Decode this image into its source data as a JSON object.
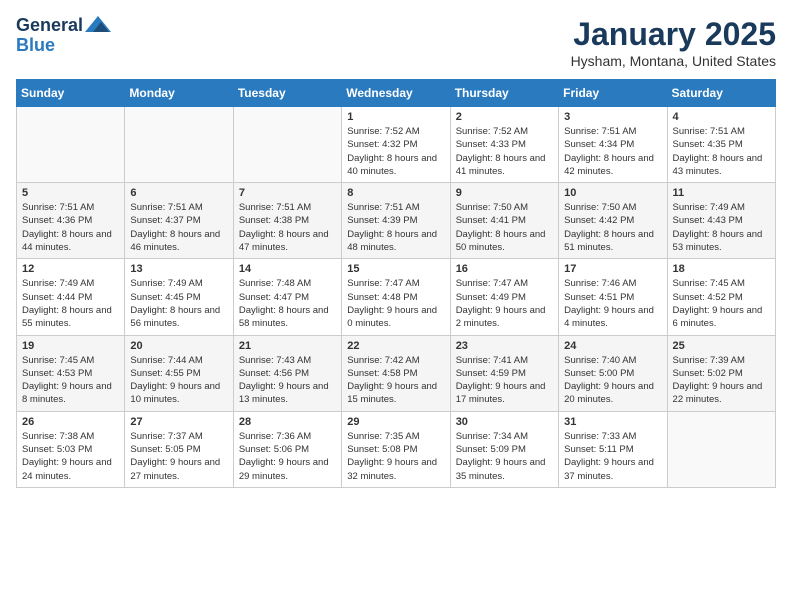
{
  "logo": {
    "general": "General",
    "blue": "Blue"
  },
  "header": {
    "month": "January 2025",
    "location": "Hysham, Montana, United States"
  },
  "weekdays": [
    "Sunday",
    "Monday",
    "Tuesday",
    "Wednesday",
    "Thursday",
    "Friday",
    "Saturday"
  ],
  "weeks": [
    [
      {
        "day": "",
        "sunrise": "",
        "sunset": "",
        "daylight": ""
      },
      {
        "day": "",
        "sunrise": "",
        "sunset": "",
        "daylight": ""
      },
      {
        "day": "",
        "sunrise": "",
        "sunset": "",
        "daylight": ""
      },
      {
        "day": "1",
        "sunrise": "Sunrise: 7:52 AM",
        "sunset": "Sunset: 4:32 PM",
        "daylight": "Daylight: 8 hours and 40 minutes."
      },
      {
        "day": "2",
        "sunrise": "Sunrise: 7:52 AM",
        "sunset": "Sunset: 4:33 PM",
        "daylight": "Daylight: 8 hours and 41 minutes."
      },
      {
        "day": "3",
        "sunrise": "Sunrise: 7:51 AM",
        "sunset": "Sunset: 4:34 PM",
        "daylight": "Daylight: 8 hours and 42 minutes."
      },
      {
        "day": "4",
        "sunrise": "Sunrise: 7:51 AM",
        "sunset": "Sunset: 4:35 PM",
        "daylight": "Daylight: 8 hours and 43 minutes."
      }
    ],
    [
      {
        "day": "5",
        "sunrise": "Sunrise: 7:51 AM",
        "sunset": "Sunset: 4:36 PM",
        "daylight": "Daylight: 8 hours and 44 minutes."
      },
      {
        "day": "6",
        "sunrise": "Sunrise: 7:51 AM",
        "sunset": "Sunset: 4:37 PM",
        "daylight": "Daylight: 8 hours and 46 minutes."
      },
      {
        "day": "7",
        "sunrise": "Sunrise: 7:51 AM",
        "sunset": "Sunset: 4:38 PM",
        "daylight": "Daylight: 8 hours and 47 minutes."
      },
      {
        "day": "8",
        "sunrise": "Sunrise: 7:51 AM",
        "sunset": "Sunset: 4:39 PM",
        "daylight": "Daylight: 8 hours and 48 minutes."
      },
      {
        "day": "9",
        "sunrise": "Sunrise: 7:50 AM",
        "sunset": "Sunset: 4:41 PM",
        "daylight": "Daylight: 8 hours and 50 minutes."
      },
      {
        "day": "10",
        "sunrise": "Sunrise: 7:50 AM",
        "sunset": "Sunset: 4:42 PM",
        "daylight": "Daylight: 8 hours and 51 minutes."
      },
      {
        "day": "11",
        "sunrise": "Sunrise: 7:49 AM",
        "sunset": "Sunset: 4:43 PM",
        "daylight": "Daylight: 8 hours and 53 minutes."
      }
    ],
    [
      {
        "day": "12",
        "sunrise": "Sunrise: 7:49 AM",
        "sunset": "Sunset: 4:44 PM",
        "daylight": "Daylight: 8 hours and 55 minutes."
      },
      {
        "day": "13",
        "sunrise": "Sunrise: 7:49 AM",
        "sunset": "Sunset: 4:45 PM",
        "daylight": "Daylight: 8 hours and 56 minutes."
      },
      {
        "day": "14",
        "sunrise": "Sunrise: 7:48 AM",
        "sunset": "Sunset: 4:47 PM",
        "daylight": "Daylight: 8 hours and 58 minutes."
      },
      {
        "day": "15",
        "sunrise": "Sunrise: 7:47 AM",
        "sunset": "Sunset: 4:48 PM",
        "daylight": "Daylight: 9 hours and 0 minutes."
      },
      {
        "day": "16",
        "sunrise": "Sunrise: 7:47 AM",
        "sunset": "Sunset: 4:49 PM",
        "daylight": "Daylight: 9 hours and 2 minutes."
      },
      {
        "day": "17",
        "sunrise": "Sunrise: 7:46 AM",
        "sunset": "Sunset: 4:51 PM",
        "daylight": "Daylight: 9 hours and 4 minutes."
      },
      {
        "day": "18",
        "sunrise": "Sunrise: 7:45 AM",
        "sunset": "Sunset: 4:52 PM",
        "daylight": "Daylight: 9 hours and 6 minutes."
      }
    ],
    [
      {
        "day": "19",
        "sunrise": "Sunrise: 7:45 AM",
        "sunset": "Sunset: 4:53 PM",
        "daylight": "Daylight: 9 hours and 8 minutes."
      },
      {
        "day": "20",
        "sunrise": "Sunrise: 7:44 AM",
        "sunset": "Sunset: 4:55 PM",
        "daylight": "Daylight: 9 hours and 10 minutes."
      },
      {
        "day": "21",
        "sunrise": "Sunrise: 7:43 AM",
        "sunset": "Sunset: 4:56 PM",
        "daylight": "Daylight: 9 hours and 13 minutes."
      },
      {
        "day": "22",
        "sunrise": "Sunrise: 7:42 AM",
        "sunset": "Sunset: 4:58 PM",
        "daylight": "Daylight: 9 hours and 15 minutes."
      },
      {
        "day": "23",
        "sunrise": "Sunrise: 7:41 AM",
        "sunset": "Sunset: 4:59 PM",
        "daylight": "Daylight: 9 hours and 17 minutes."
      },
      {
        "day": "24",
        "sunrise": "Sunrise: 7:40 AM",
        "sunset": "Sunset: 5:00 PM",
        "daylight": "Daylight: 9 hours and 20 minutes."
      },
      {
        "day": "25",
        "sunrise": "Sunrise: 7:39 AM",
        "sunset": "Sunset: 5:02 PM",
        "daylight": "Daylight: 9 hours and 22 minutes."
      }
    ],
    [
      {
        "day": "26",
        "sunrise": "Sunrise: 7:38 AM",
        "sunset": "Sunset: 5:03 PM",
        "daylight": "Daylight: 9 hours and 24 minutes."
      },
      {
        "day": "27",
        "sunrise": "Sunrise: 7:37 AM",
        "sunset": "Sunset: 5:05 PM",
        "daylight": "Daylight: 9 hours and 27 minutes."
      },
      {
        "day": "28",
        "sunrise": "Sunrise: 7:36 AM",
        "sunset": "Sunset: 5:06 PM",
        "daylight": "Daylight: 9 hours and 29 minutes."
      },
      {
        "day": "29",
        "sunrise": "Sunrise: 7:35 AM",
        "sunset": "Sunset: 5:08 PM",
        "daylight": "Daylight: 9 hours and 32 minutes."
      },
      {
        "day": "30",
        "sunrise": "Sunrise: 7:34 AM",
        "sunset": "Sunset: 5:09 PM",
        "daylight": "Daylight: 9 hours and 35 minutes."
      },
      {
        "day": "31",
        "sunrise": "Sunrise: 7:33 AM",
        "sunset": "Sunset: 5:11 PM",
        "daylight": "Daylight: 9 hours and 37 minutes."
      },
      {
        "day": "",
        "sunrise": "",
        "sunset": "",
        "daylight": ""
      }
    ]
  ]
}
